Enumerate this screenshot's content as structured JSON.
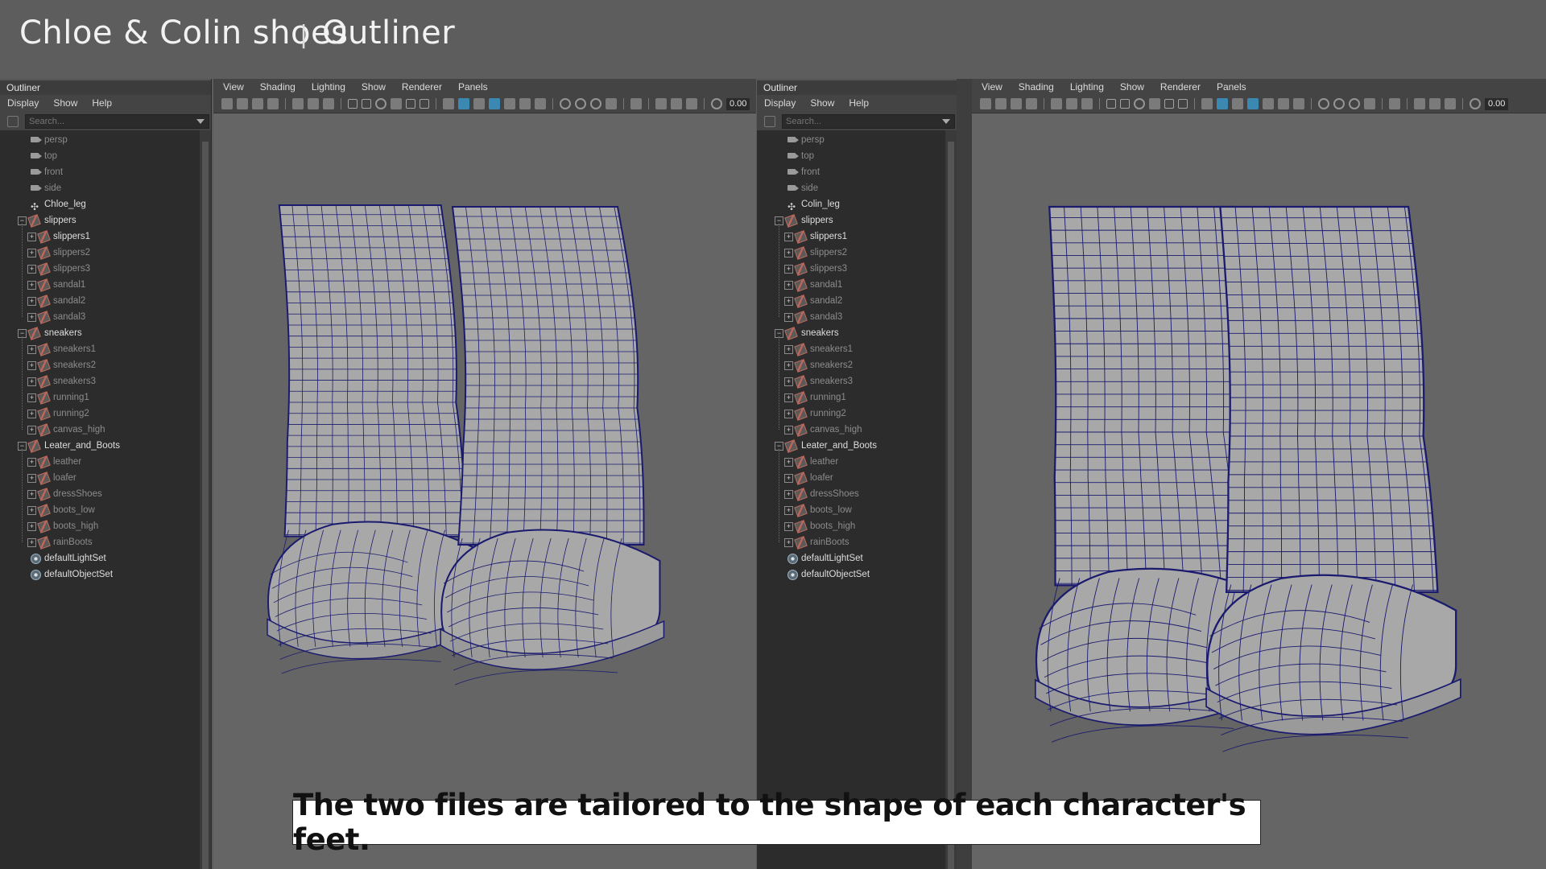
{
  "header": {
    "title_main": "Chloe & Colin shoes",
    "separator": "|",
    "title_section": "Outliner"
  },
  "left_outliner": {
    "title": "Outliner",
    "menu": [
      "Display",
      "Show",
      "Help"
    ],
    "search_placeholder": "Search...",
    "items": [
      {
        "label": "persp",
        "type": "camera",
        "level": 0,
        "style": "dim"
      },
      {
        "label": "top",
        "type": "camera",
        "level": 0,
        "style": "dim"
      },
      {
        "label": "front",
        "type": "camera",
        "level": 0,
        "style": "dim"
      },
      {
        "label": "side",
        "type": "camera",
        "level": 0,
        "style": "dim"
      },
      {
        "label": "Chloe_leg",
        "type": "locator",
        "level": 0,
        "style": "bright"
      },
      {
        "label": "slippers",
        "type": "group",
        "level": 0,
        "style": "bright",
        "expand": "minus"
      },
      {
        "label": "slippers1",
        "type": "group",
        "level": 1,
        "style": "bright",
        "expand": "plus"
      },
      {
        "label": "slippers2",
        "type": "group",
        "level": 1,
        "style": "dim",
        "expand": "plus"
      },
      {
        "label": "slippers3",
        "type": "group",
        "level": 1,
        "style": "dim",
        "expand": "plus"
      },
      {
        "label": "sandal1",
        "type": "group",
        "level": 1,
        "style": "dim",
        "expand": "plus"
      },
      {
        "label": "sandal2",
        "type": "group",
        "level": 1,
        "style": "dim",
        "expand": "plus"
      },
      {
        "label": "sandal3",
        "type": "group",
        "level": 1,
        "style": "dim",
        "expand": "plus"
      },
      {
        "label": "sneakers",
        "type": "group",
        "level": 0,
        "style": "bright",
        "expand": "minus"
      },
      {
        "label": "sneakers1",
        "type": "group",
        "level": 1,
        "style": "dim",
        "expand": "plus"
      },
      {
        "label": "sneakers2",
        "type": "group",
        "level": 1,
        "style": "dim",
        "expand": "plus"
      },
      {
        "label": "sneakers3",
        "type": "group",
        "level": 1,
        "style": "dim",
        "expand": "plus"
      },
      {
        "label": "running1",
        "type": "group",
        "level": 1,
        "style": "dim",
        "expand": "plus"
      },
      {
        "label": "running2",
        "type": "group",
        "level": 1,
        "style": "dim",
        "expand": "plus"
      },
      {
        "label": "canvas_high",
        "type": "group",
        "level": 1,
        "style": "dim",
        "expand": "plus"
      },
      {
        "label": "Leater_and_Boots",
        "type": "group",
        "level": 0,
        "style": "bright",
        "expand": "minus"
      },
      {
        "label": "leather",
        "type": "group",
        "level": 1,
        "style": "dim",
        "expand": "plus"
      },
      {
        "label": "loafer",
        "type": "group",
        "level": 1,
        "style": "dim",
        "expand": "plus"
      },
      {
        "label": "dressShoes",
        "type": "group",
        "level": 1,
        "style": "dim",
        "expand": "plus"
      },
      {
        "label": "boots_low",
        "type": "group",
        "level": 1,
        "style": "dim",
        "expand": "plus"
      },
      {
        "label": "boots_high",
        "type": "group",
        "level": 1,
        "style": "dim",
        "expand": "plus"
      },
      {
        "label": "rainBoots",
        "type": "group",
        "level": 1,
        "style": "dim",
        "expand": "plus"
      },
      {
        "label": "defaultLightSet",
        "type": "set",
        "level": 0,
        "style": "bright"
      },
      {
        "label": "defaultObjectSet",
        "type": "set",
        "level": 0,
        "style": "bright"
      }
    ]
  },
  "left_viewport": {
    "menu": [
      "View",
      "Shading",
      "Lighting",
      "Show",
      "Renderer",
      "Panels"
    ],
    "field_value": "0.00"
  },
  "right_outliner": {
    "title": "Outliner",
    "menu": [
      "Display",
      "Show",
      "Help"
    ],
    "search_placeholder": "Search...",
    "items": [
      {
        "label": "persp",
        "type": "camera",
        "level": 0,
        "style": "dim"
      },
      {
        "label": "top",
        "type": "camera",
        "level": 0,
        "style": "dim"
      },
      {
        "label": "front",
        "type": "camera",
        "level": 0,
        "style": "dim"
      },
      {
        "label": "side",
        "type": "camera",
        "level": 0,
        "style": "dim"
      },
      {
        "label": "Colin_leg",
        "type": "locator",
        "level": 0,
        "style": "bright"
      },
      {
        "label": "slippers",
        "type": "group",
        "level": 0,
        "style": "bright",
        "expand": "minus"
      },
      {
        "label": "slippers1",
        "type": "group",
        "level": 1,
        "style": "bright",
        "expand": "plus"
      },
      {
        "label": "slippers2",
        "type": "group",
        "level": 1,
        "style": "dim",
        "expand": "plus"
      },
      {
        "label": "slippers3",
        "type": "group",
        "level": 1,
        "style": "dim",
        "expand": "plus"
      },
      {
        "label": "sandal1",
        "type": "group",
        "level": 1,
        "style": "dim",
        "expand": "plus"
      },
      {
        "label": "sandal2",
        "type": "group",
        "level": 1,
        "style": "dim",
        "expand": "plus"
      },
      {
        "label": "sandal3",
        "type": "group",
        "level": 1,
        "style": "dim",
        "expand": "plus"
      },
      {
        "label": "sneakers",
        "type": "group",
        "level": 0,
        "style": "bright",
        "expand": "minus"
      },
      {
        "label": "sneakers1",
        "type": "group",
        "level": 1,
        "style": "dim",
        "expand": "plus"
      },
      {
        "label": "sneakers2",
        "type": "group",
        "level": 1,
        "style": "dim",
        "expand": "plus"
      },
      {
        "label": "sneakers3",
        "type": "group",
        "level": 1,
        "style": "dim",
        "expand": "plus"
      },
      {
        "label": "running1",
        "type": "group",
        "level": 1,
        "style": "dim",
        "expand": "plus"
      },
      {
        "label": "running2",
        "type": "group",
        "level": 1,
        "style": "dim",
        "expand": "plus"
      },
      {
        "label": "canvas_high",
        "type": "group",
        "level": 1,
        "style": "dim",
        "expand": "plus"
      },
      {
        "label": "Leater_and_Boots",
        "type": "group",
        "level": 0,
        "style": "bright",
        "expand": "minus"
      },
      {
        "label": "leather",
        "type": "group",
        "level": 1,
        "style": "dim",
        "expand": "plus"
      },
      {
        "label": "loafer",
        "type": "group",
        "level": 1,
        "style": "dim",
        "expand": "plus"
      },
      {
        "label": "dressShoes",
        "type": "group",
        "level": 1,
        "style": "dim",
        "expand": "plus"
      },
      {
        "label": "boots_low",
        "type": "group",
        "level": 1,
        "style": "dim",
        "expand": "plus"
      },
      {
        "label": "boots_high",
        "type": "group",
        "level": 1,
        "style": "dim",
        "expand": "plus"
      },
      {
        "label": "rainBoots",
        "type": "group",
        "level": 1,
        "style": "dim",
        "expand": "plus"
      },
      {
        "label": "defaultLightSet",
        "type": "set",
        "level": 0,
        "style": "bright"
      },
      {
        "label": "defaultObjectSet",
        "type": "set",
        "level": 0,
        "style": "bright"
      }
    ]
  },
  "right_viewport": {
    "menu": [
      "View",
      "Shading",
      "Lighting",
      "Show",
      "Renderer",
      "Panels"
    ],
    "field_value": "0.00"
  },
  "caption": "The two files are tailored to the shape of each character's feet.",
  "colors": {
    "background": "#5d5d5d",
    "viewport": "#656565",
    "wireframe": "#1a1a6e",
    "mesh": "#a8a8a8",
    "panel": "#444444"
  }
}
